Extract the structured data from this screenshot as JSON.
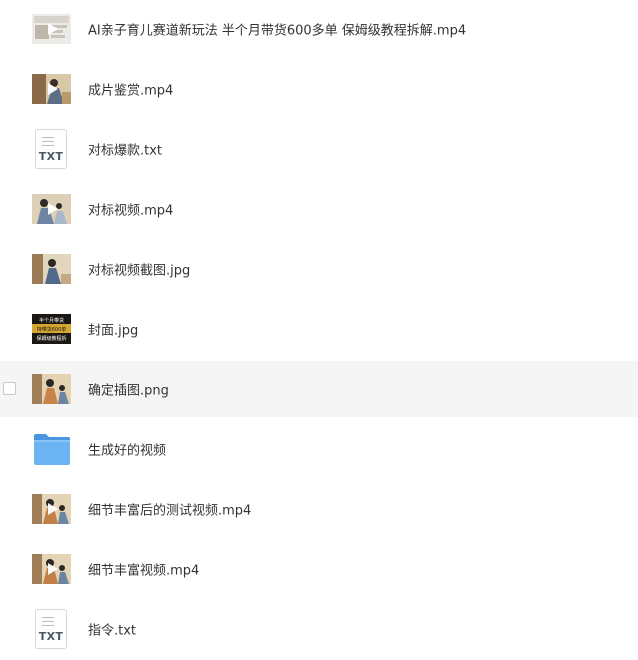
{
  "files": [
    {
      "name": "AI亲子育儿赛道新玩法 半个月带货600多单 保姆级教程拆解.mp4",
      "icon": "video-thumbnail-icon"
    },
    {
      "name": "成片鉴赏.mp4",
      "icon": "video-thumbnail-icon"
    },
    {
      "name": "对标爆款.txt",
      "icon": "txt-file-icon",
      "ext": "TXT"
    },
    {
      "name": "对标视频.mp4",
      "icon": "video-thumbnail-icon"
    },
    {
      "name": "对标视频截图.jpg",
      "icon": "image-thumbnail-icon"
    },
    {
      "name": "封面.jpg",
      "icon": "image-thumbnail-icon",
      "cover_lines": [
        "半个月带货",
        "持带货600单",
        "保姆级教程拆"
      ]
    },
    {
      "name": "确定插图.png",
      "icon": "image-thumbnail-icon"
    },
    {
      "name": "生成好的视频",
      "icon": "folder-icon"
    },
    {
      "name": "细节丰富后的测试视频.mp4",
      "icon": "video-thumbnail-icon"
    },
    {
      "name": "细节丰富视频.mp4",
      "icon": "video-thumbnail-icon"
    },
    {
      "name": "指令.txt",
      "icon": "txt-file-icon",
      "ext": "TXT"
    }
  ],
  "colors": {
    "hover_row": "#f5f5f5",
    "folder": "#5aa7f0",
    "text": "#333333"
  }
}
